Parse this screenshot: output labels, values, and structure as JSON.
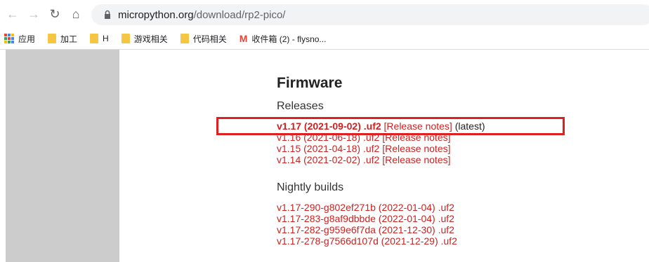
{
  "browser": {
    "url_host": "micropython.org",
    "url_path": "/download/rp2-pico/",
    "bookmarks": [
      {
        "label": "应用",
        "icon": "apps-grid-icon"
      },
      {
        "label": "加工",
        "icon": "folder-icon"
      },
      {
        "label": "H",
        "icon": "folder-icon"
      },
      {
        "label": "游戏相关",
        "icon": "folder-icon"
      },
      {
        "label": "代码相关",
        "icon": "folder-icon"
      },
      {
        "label": "收件箱 (2) - flysno...",
        "icon": "gmail-icon"
      }
    ]
  },
  "page": {
    "title": "Firmware",
    "releases_heading": "Releases",
    "releases": [
      {
        "file": "v1.17 (2021-09-02) .uf2",
        "notes": "[Release notes]",
        "tag": "(latest)"
      },
      {
        "file": "v1.16 (2021-06-18) .uf2",
        "notes": "[Release notes]"
      },
      {
        "file": "v1.15 (2021-04-18) .uf2",
        "notes": "[Release notes]"
      },
      {
        "file": "v1.14 (2021-02-02) .uf2",
        "notes": "[Release notes]"
      }
    ],
    "nightly_heading": "Nightly builds",
    "nightly": [
      "v1.17-290-g802ef271b (2022-01-04) .uf2",
      "v1.17-283-g8af9dbbde (2022-01-04) .uf2",
      "v1.17-282-g959e6f7da (2021-12-30) .uf2",
      "v1.17-278-g7566d107d (2021-12-29) .uf2"
    ]
  },
  "colors": {
    "link": "#cc2222",
    "highlight_box": "#e02020",
    "folder": "#f6c544"
  }
}
